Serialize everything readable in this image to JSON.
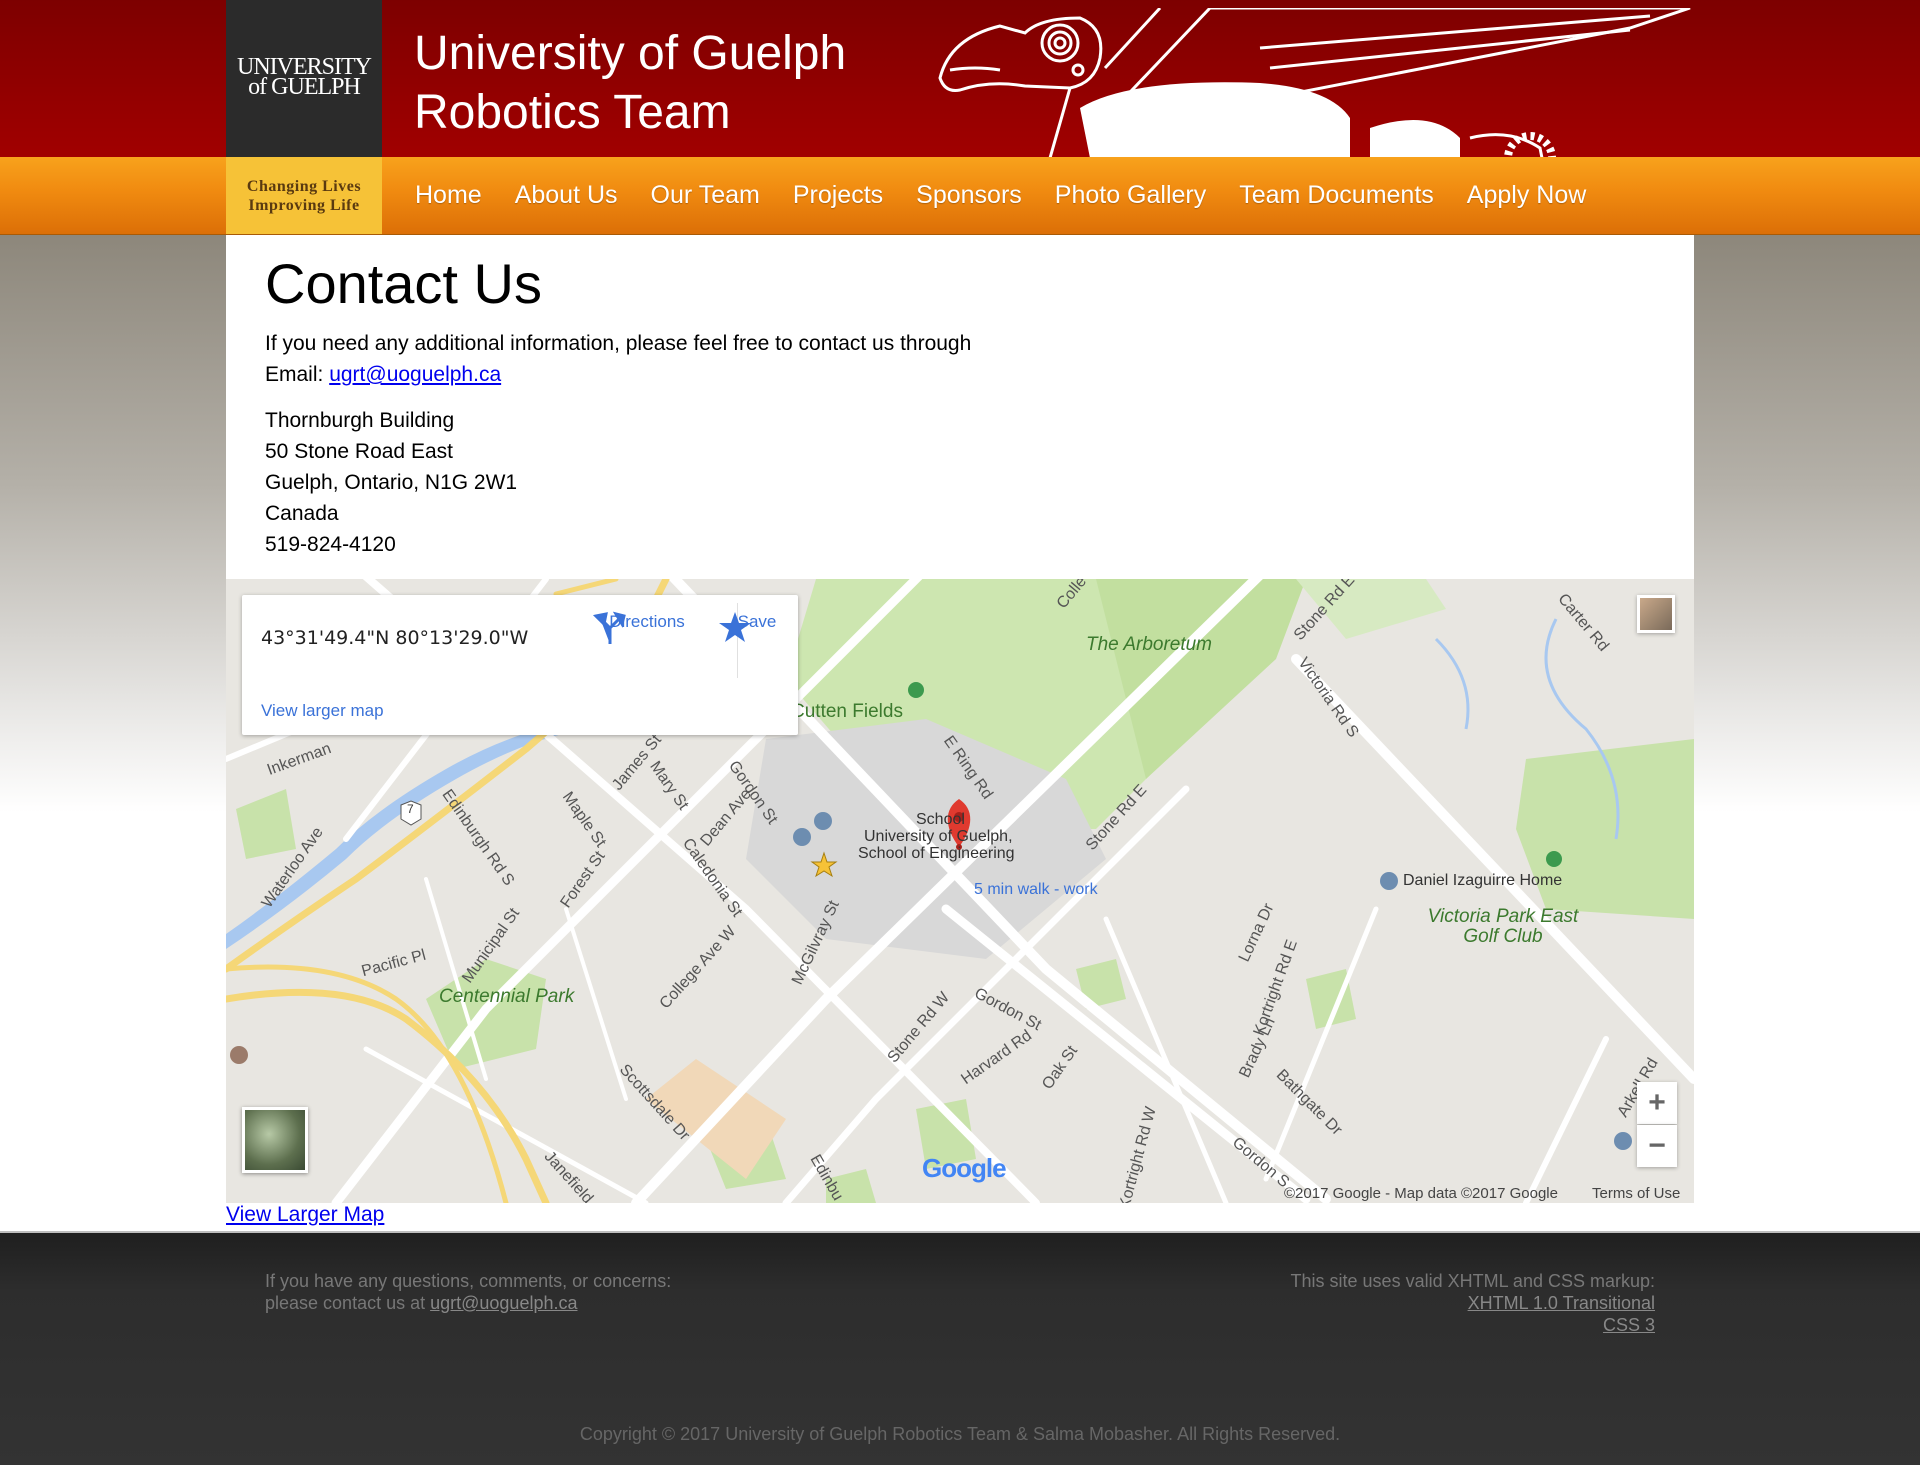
{
  "header": {
    "logo_line1": "UNIVERSITY",
    "logo_line2": "of GUELPH",
    "title_line1": "University of Guelph",
    "title_line2": "Robotics Team",
    "tagline_line1": "Changing Lives",
    "tagline_line2": "Improving Life"
  },
  "nav": {
    "items": [
      "Home",
      "About Us",
      "Our Team",
      "Projects",
      "Sponsors",
      "Photo Gallery",
      "Team Documents",
      "Apply Now"
    ]
  },
  "contact": {
    "title": "Contact Us",
    "intro": "If you need any additional information, please feel free to contact us through",
    "email_label": "Email: ",
    "email": "ugrt@uoguelph.ca",
    "address": [
      "Thornburgh Building",
      "50 Stone Road East",
      "Guelph, Ontario, N1G 2W1",
      "Canada",
      "519-824-4120"
    ]
  },
  "map": {
    "coords": "43°31'49.4\"N 80°13'29.0\"W",
    "directions": "Directions",
    "save": "Save",
    "view_larger_inner": "View larger map",
    "pin_label": "5 min walk - work",
    "attribution": "©2017 Google - Map data ©2017 Google",
    "terms": "Terms of Use",
    "google": "Google",
    "zoom_in": "+",
    "zoom_out": "−",
    "labels": {
      "arboretum": "The Arboretum",
      "centennial": "Centennial Park",
      "victoria_park": "Victoria Park East Golf Club",
      "izaguirre": "Daniel Izaguirre Home",
      "school": "School",
      "univ": "University of Guelph,",
      "school_eng": "School of Engineering",
      "cutten": "Cutten Fields",
      "stone_rd_e_top": "Stone Rd E",
      "victoria_rd": "Victoria Rd S",
      "carter": "Carter Rd",
      "gordon": "Gordon St",
      "stone_rd_w": "Stone Rd W",
      "college": "College Ave W",
      "edinburgh": "Edinburgh Rd S",
      "waterloo": "Waterloo Ave",
      "pacific": "Pacific Pl",
      "municipal": "Municipal St",
      "forest": "Forest St",
      "maple": "Maple St",
      "mary": "Mary St",
      "james": "James St",
      "dean": "Dean Ave",
      "caledonia": "Caledonia St",
      "mcgilvray": "McGilvray St",
      "ering": "E Ring Rd",
      "stone_rd_e_mid": "Stone Rd E",
      "harvard": "Harvard Rd",
      "oak": "Oak St",
      "kortright_w": "Kortright Rd W",
      "kortright_e": "Kortright Rd E",
      "brady": "Brady Ln",
      "bathgate": "Bathgate Dr",
      "lorna": "Lorna Dr",
      "scottsdale": "Scottsdale Dr",
      "janefield": "Janefield",
      "inkerman": "Inkerman",
      "arkell": "Arkell Rd",
      "gordon_s": "Gordon S",
      "college_top": "Colle",
      "edinbu": "Edinbu",
      "hwy7": "7"
    }
  },
  "page": {
    "view_larger_map": "View Larger Map"
  },
  "footer": {
    "left_line1": "If you have any questions, comments, or concerns:",
    "left_line2_prefix": "please contact us at ",
    "left_email": "ugrt@uoguelph.ca",
    "right_line1": "This site uses valid XHTML and CSS markup:",
    "right_link1": "XHTML 1.0 Transitional",
    "right_link2": "CSS 3",
    "copyright": "Copyright © 2017 University of Guelph Robotics Team & Salma Mobasher. All Rights Reserved."
  },
  "colors": {
    "header_red": "#930000",
    "nav_orange": "#f08a10",
    "tagline_gold": "#f6c237",
    "link_blue": "#0000ee",
    "map_blue": "#3a72d8",
    "pin_red": "#e03a2f"
  }
}
